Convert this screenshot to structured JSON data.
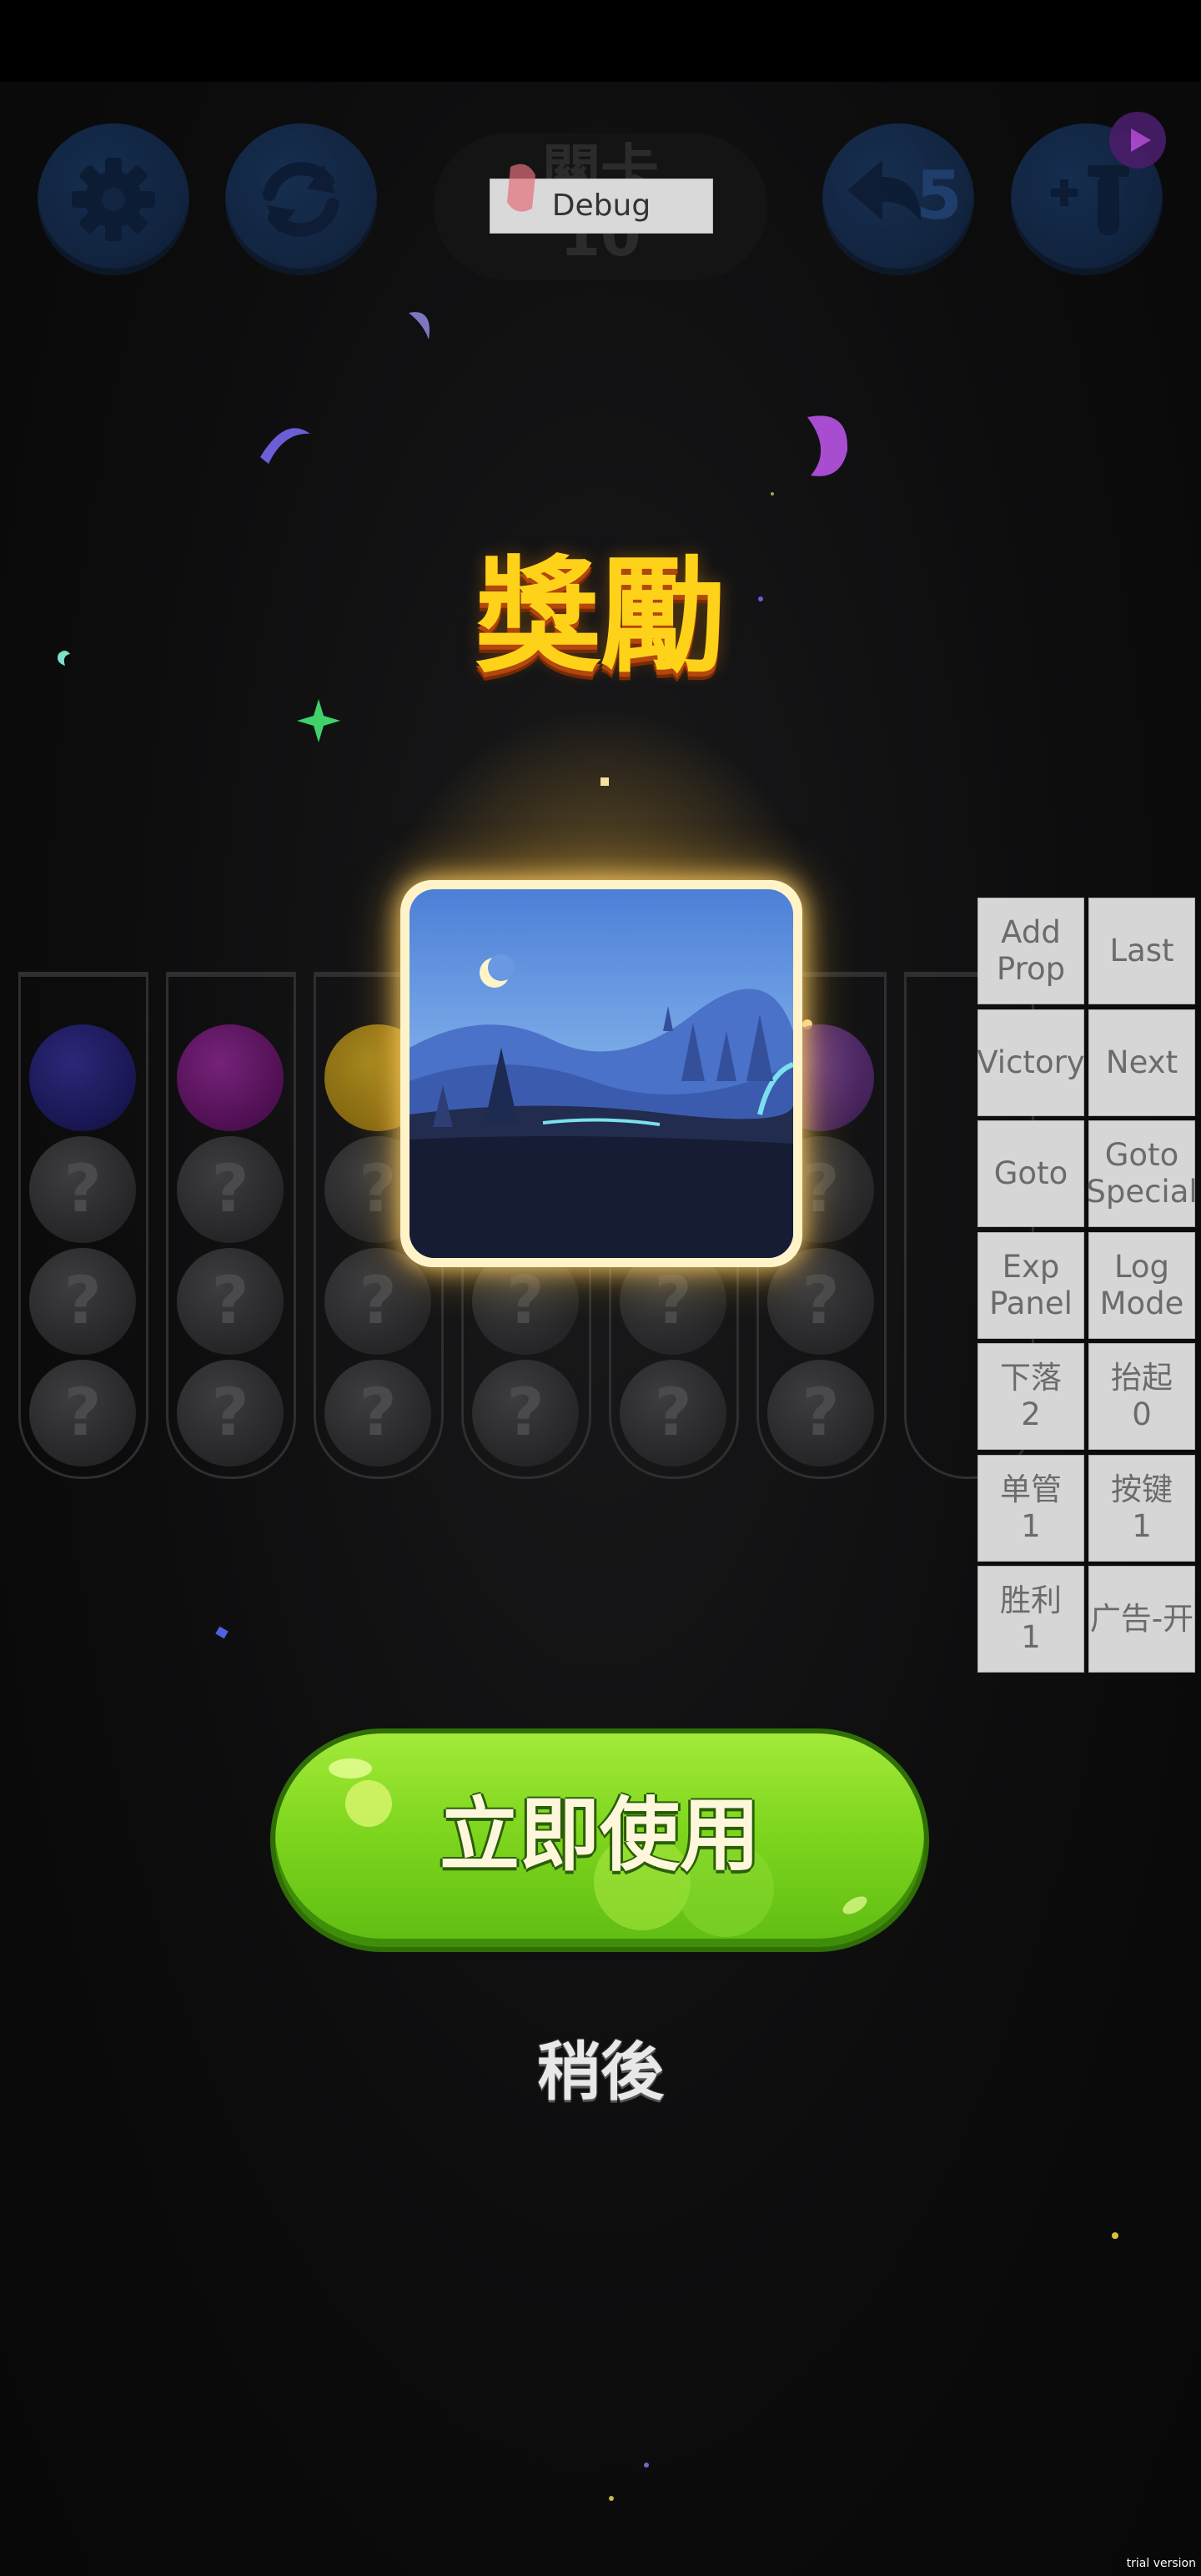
{
  "top_bar": {
    "level_text": "關卡\n10",
    "debug_label": "Debug",
    "undo_count": "5"
  },
  "reward": {
    "title": "獎勵",
    "use_button_label": "立即使用",
    "later_label": "稍後"
  },
  "tubes": {
    "hidden_ball_symbol": "?",
    "top_ball_colors": [
      "#1e1a6e",
      "#6a0f6e",
      "#b48a10",
      "#1e1e1e",
      "#1e1e1e",
      "#5a2a7a",
      "none"
    ]
  },
  "debug_panel": {
    "buttons": [
      "Add\nProp",
      "Last",
      "Victory",
      "Next",
      "Goto",
      "Goto\nSpecial",
      "Exp\nPanel",
      "Log\nMode",
      "下落\n2",
      "抬起\n0",
      "单管\n1",
      "按键\n1",
      "胜利\n1",
      "广告-开"
    ]
  },
  "watermark": "trial version",
  "colors": {
    "title_yellow": "#ffd21a",
    "use_button_green": "#7fd61e",
    "round_button_blue": "#1f4a86"
  },
  "icons": [
    "gear-icon",
    "refresh-icon",
    "undo-arrow-icon",
    "add-tube-icon",
    "video-ad-icon"
  ]
}
